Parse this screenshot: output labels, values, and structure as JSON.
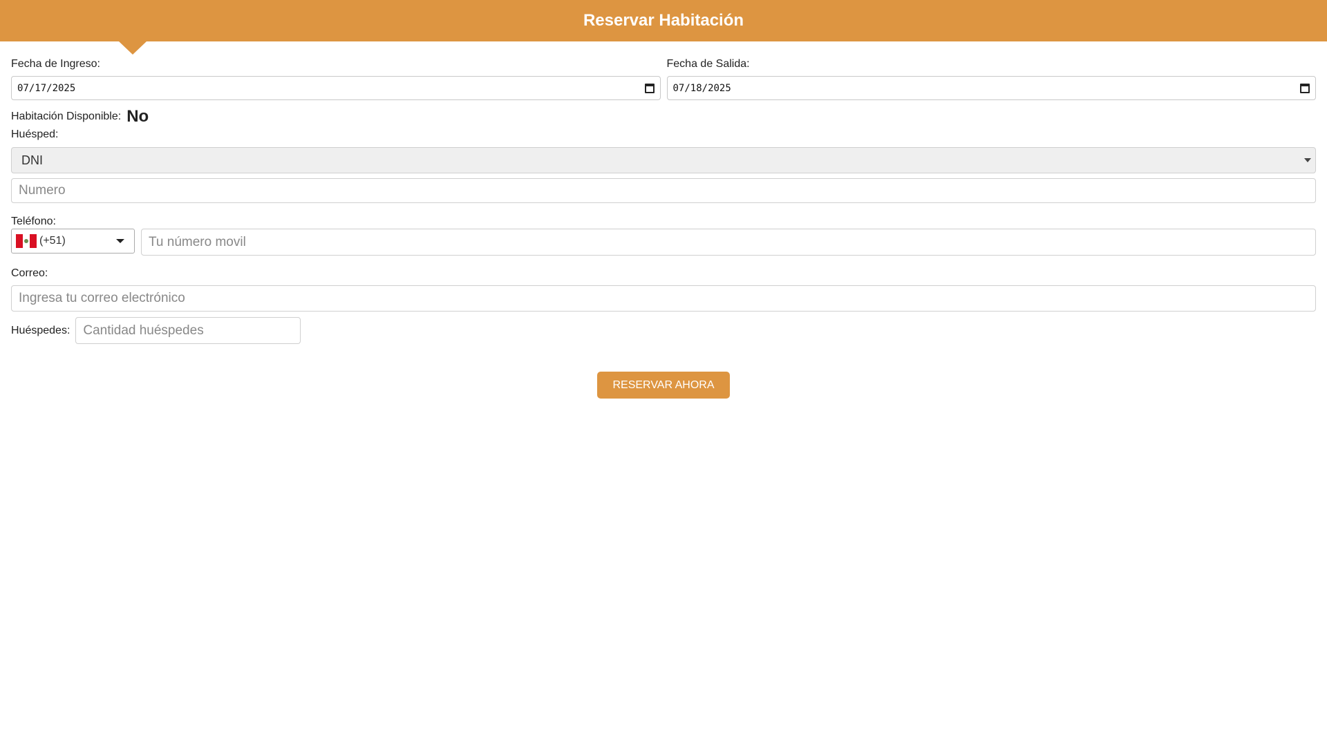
{
  "header": {
    "title": "Reservar Habitación"
  },
  "checkin": {
    "label": "Fecha de Ingreso:",
    "value": "07/17/2025"
  },
  "checkout": {
    "label": "Fecha de Salida:",
    "value": "07/18/2025"
  },
  "availability": {
    "label": "Habitación Disponible:",
    "value": "No"
  },
  "guest": {
    "label": "Huésped:",
    "doc_type": "DNI",
    "number_placeholder": "Numero"
  },
  "phone": {
    "label": "Teléfono:",
    "country_code": "(+51)",
    "flag_icon": "peru-flag-icon",
    "placeholder": "Tu número movil"
  },
  "email": {
    "label": "Correo:",
    "placeholder": "Ingresa tu correo electrónico"
  },
  "guests": {
    "label": "Huéspedes:",
    "placeholder": "Cantidad huéspedes"
  },
  "submit": {
    "label": "RESERVAR AHORA"
  },
  "colors": {
    "accent": "#dd9541",
    "flag_red": "#d91023"
  }
}
